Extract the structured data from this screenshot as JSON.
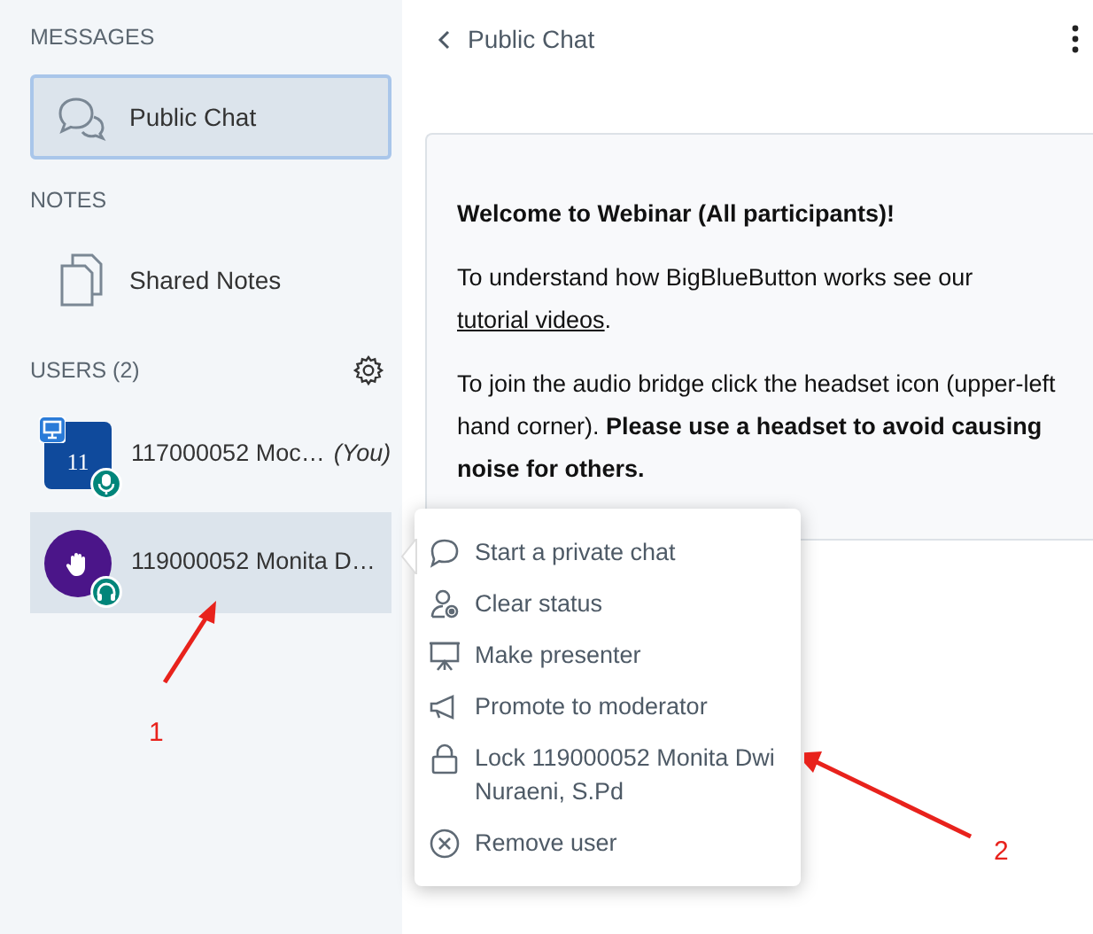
{
  "sidebar": {
    "sections": [
      {
        "title": "MESSAGES",
        "items": [
          {
            "kind": "chat",
            "label": "Public Chat",
            "selected": true
          }
        ]
      },
      {
        "title": "NOTES",
        "items": [
          {
            "kind": "notes",
            "label": "Shared Notes",
            "selected": false
          }
        ]
      }
    ],
    "users": {
      "title": "USERS (2)",
      "list": [
        {
          "kind": "square",
          "color": "#0f4a9c",
          "avatar_text": "11",
          "presenter": true,
          "microphone": true,
          "name": "117000052 Moc…",
          "you": "(You)",
          "selected": false
        },
        {
          "kind": "circle",
          "color": "#4b1589",
          "hand_raised": true,
          "headset": true,
          "name": "119000052 Monita D…",
          "selected": true
        }
      ]
    }
  },
  "chat": {
    "title": "Public Chat",
    "welcome": [
      {
        "text": "Welcome to Webinar (All participants)!",
        "bold": true
      },
      {
        "text": "To understand how BigBlueButton works see our",
        "link": "tutorial videos",
        "after": "."
      },
      {
        "text": "To join the audio bridge click the headset icon (upper-left hand corner). **Please use a headset to avoid causing noise for others.**"
      }
    ]
  },
  "user_menu": [
    {
      "kind": "chat",
      "label": "Start a private chat"
    },
    {
      "kind": "status",
      "label": "Clear status"
    },
    {
      "kind": "presenter",
      "label": "Make presenter"
    },
    {
      "kind": "promote",
      "label": "Promote to moderator"
    },
    {
      "kind": "lock",
      "label": "Lock 119000052 Monita Dwi Nuraeni, S.Pd"
    },
    {
      "kind": "remove",
      "label": "Remove user"
    }
  ],
  "annotations": [
    {
      "label": "1"
    },
    {
      "label": "2"
    }
  ]
}
